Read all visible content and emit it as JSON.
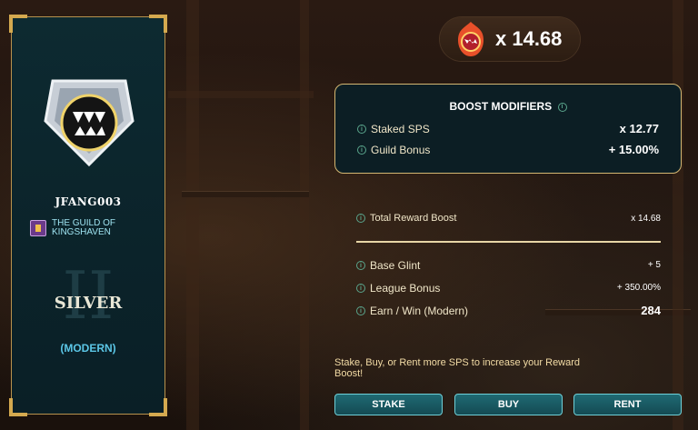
{
  "reward": {
    "multiplier_text": "x 14.68",
    "icon": "glint-icon"
  },
  "profile": {
    "player_name": "JFANG003",
    "guild_name": "THE GUILD OF KINGSHAVEN",
    "league_roman": "II",
    "league_name": "SILVER",
    "league_format": "(MODERN)"
  },
  "boost": {
    "title": "BOOST MODIFIERS",
    "rows": [
      {
        "label": "Staked SPS",
        "value": "x 12.77"
      },
      {
        "label": "Guild Bonus",
        "value": "+ 15.00%"
      }
    ]
  },
  "summary": {
    "total_label": "Total Reward Boost",
    "total_value": "x 14.68",
    "rows": [
      {
        "label": "Base Glint",
        "value": "+ 5"
      },
      {
        "label": "League Bonus",
        "value": "+ 350.00%"
      },
      {
        "label": "Earn / Win (Modern)",
        "value": "284"
      }
    ]
  },
  "cta": "Stake, Buy, or Rent more SPS to increase your Reward Boost!",
  "buttons": {
    "stake": "STAKE",
    "buy": "BUY",
    "rent": "RENT"
  },
  "colors": {
    "panel": "#0b232a",
    "gold": "#d4b772",
    "info": "#5aa58c",
    "button": "#1f6a73",
    "guild_text": "#9ee3f0",
    "format_text": "#5bc6e6"
  }
}
